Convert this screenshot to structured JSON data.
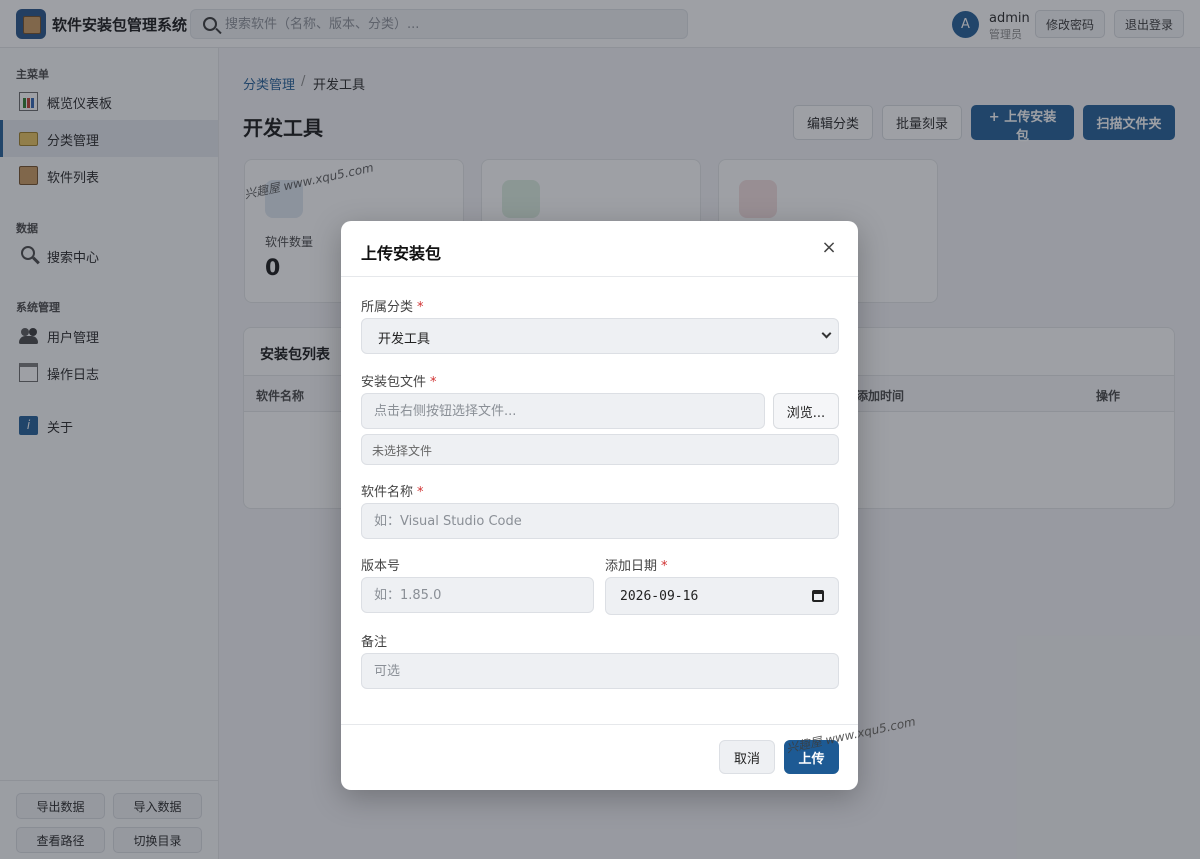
{
  "header": {
    "app_title": "软件安装包管理系统",
    "search_placeholder": "搜索软件（名称、版本、分类）...",
    "avatar_letter": "A",
    "user_name": "admin",
    "user_role": "管理员",
    "change_password_label": "修改密码",
    "logout_label": "退出登录"
  },
  "sidebar": {
    "group_main": "主菜单",
    "group_data": "数据",
    "group_system": "系统管理",
    "items": [
      {
        "label": "概览仪表板",
        "icon": "chart-icon"
      },
      {
        "label": "分类管理",
        "icon": "folder-icon"
      },
      {
        "label": "软件列表",
        "icon": "box-icon"
      },
      {
        "label": "搜索中心",
        "icon": "search-icon"
      },
      {
        "label": "用户管理",
        "icon": "users-icon"
      },
      {
        "label": "操作日志",
        "icon": "log-icon"
      },
      {
        "label": "关于",
        "icon": "info-icon"
      }
    ],
    "footer": {
      "export_label": "导出数据",
      "import_label": "导入数据",
      "view_path_label": "查看路径",
      "switch_dir_label": "切换目录"
    }
  },
  "main": {
    "breadcrumb_parent": "分类管理",
    "breadcrumb_sep": "/",
    "breadcrumb_current": "开发工具",
    "page_title": "开发工具",
    "buttons": {
      "edit_category": "编辑分类",
      "batch_burn": "批量刻录",
      "upload_package": "+ 上传安装包",
      "scan_folder": "扫描文件夹"
    },
    "stat_cards": [
      {
        "label": "软件数量",
        "value": "0",
        "icon": "box-icon"
      },
      {
        "label": "",
        "value": "",
        "icon": "floppy-icon"
      },
      {
        "label": "",
        "value": "",
        "icon": "calendar-icon"
      }
    ],
    "list": {
      "title": "安装包列表",
      "columns": [
        "软件名称",
        "添加时间",
        "操作"
      ]
    }
  },
  "modal": {
    "title": "上传安装包",
    "close_symbol": "×",
    "category_label": "所属分类",
    "category_value": "开发工具",
    "file_label": "安装包文件",
    "file_placeholder": "点击右侧按钮选择文件...",
    "browse_label": "浏览...",
    "file_status": "未选择文件",
    "name_label": "软件名称",
    "name_placeholder": "如：Visual Studio Code",
    "version_label": "版本号",
    "version_placeholder": "如：1.85.0",
    "date_label": "添加日期",
    "date_value": "2026-09-16",
    "notes_label": "备注",
    "notes_placeholder": "可选",
    "required_mark": "*",
    "cancel_label": "取消",
    "upload_label": "上传"
  },
  "watermark": "兴趣屋 www.xqu5.com",
  "colors": {
    "accent": "#1d5a94",
    "required": "#d03030"
  }
}
